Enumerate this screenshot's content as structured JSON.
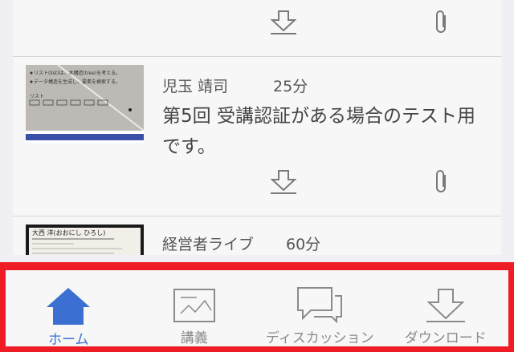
{
  "lectures": [
    {
      "instructor": "児玉 靖司",
      "duration": "25分",
      "title": "第5回 受講認証がある場合のテスト用です。",
      "thumbnail_lines": [
        "リスト(list)は、木構造(tree)を考える。",
        "データ構造を生成し、要素を検索する。",
        "リスト"
      ]
    },
    {
      "instructor": "経営者ライブ",
      "duration": "60分",
      "thumbnail_lines": [
        "大西 洋(おおにし ひろし)"
      ]
    }
  ],
  "tabs": [
    {
      "label": "ホーム",
      "icon": "home-icon",
      "active": true
    },
    {
      "label": "講義",
      "icon": "lecture-icon",
      "active": false
    },
    {
      "label": "ディスカッション",
      "icon": "discussion-icon",
      "active": false
    },
    {
      "label": "ダウンロード",
      "icon": "download-icon",
      "active": false
    }
  ],
  "colors": {
    "accent": "#3b6fd1",
    "highlight_border": "#ee1c25",
    "inactive": "#8a8a8a"
  }
}
